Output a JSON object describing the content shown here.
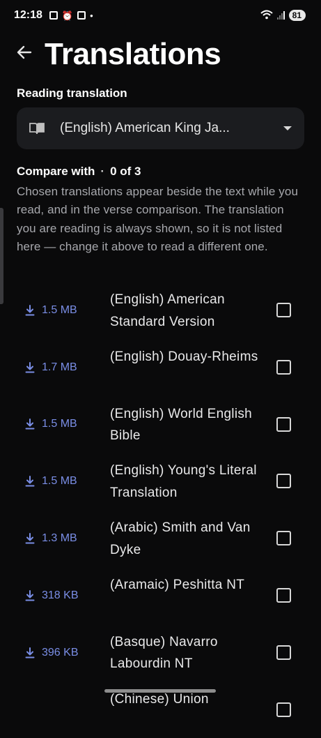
{
  "status_bar": {
    "time": "12:18",
    "battery": "81"
  },
  "header": {
    "title": "Translations"
  },
  "reading": {
    "label": "Reading translation",
    "selected": "(English) American King Ja..."
  },
  "compare": {
    "label": "Compare with",
    "count": "0 of 3",
    "description": "Chosen translations appear beside the text while you read, and in the verse comparison. The translation you are reading is always shown, so it is not listed here — change it above to read a different one."
  },
  "translations": [
    {
      "size": "1.5 MB",
      "name": "(English) American Standard Version",
      "checked": false
    },
    {
      "size": "1.7 MB",
      "name": "(English) Douay-Rheims",
      "checked": false
    },
    {
      "size": "1.5 MB",
      "name": "(English) World English Bible",
      "checked": false
    },
    {
      "size": "1.5 MB",
      "name": "(English) Young's Literal Translation",
      "checked": false
    },
    {
      "size": "1.3 MB",
      "name": "(Arabic) Smith and Van Dyke",
      "checked": false
    },
    {
      "size": "318 KB",
      "name": "(Aramaic) Peshitta NT",
      "checked": false
    },
    {
      "size": "396 KB",
      "name": "(Basque) Navarro Labourdin NT",
      "checked": false
    },
    {
      "size": "",
      "name": "(Chinese) Union",
      "checked": false
    }
  ],
  "colors": {
    "background": "#0a0a0b",
    "accent": "#7a8ee6",
    "card": "#1b1c1f"
  }
}
